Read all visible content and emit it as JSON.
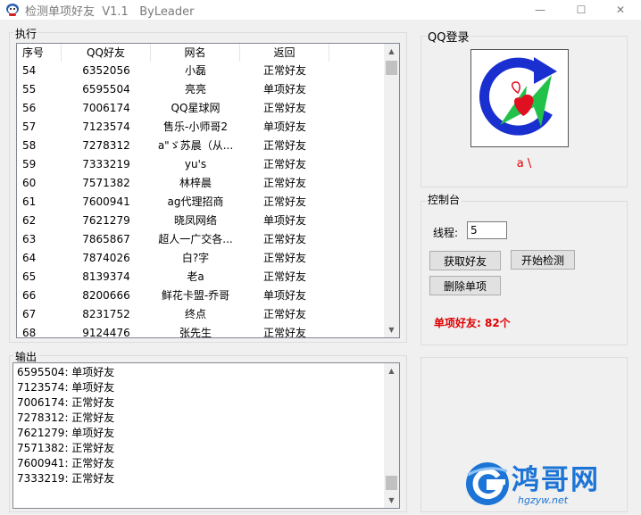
{
  "window": {
    "title": "检测单项好友  V1.1   ByLeader",
    "min_glyph": "—",
    "max_glyph": "☐",
    "close_glyph": "✕"
  },
  "exec": {
    "title": "执行",
    "columns": [
      "序号",
      "QQ好友",
      "网名",
      "返回"
    ],
    "rows": [
      {
        "num": "54",
        "qq": "6352056",
        "name": "小磊",
        "ret": "正常好友"
      },
      {
        "num": "55",
        "qq": "6595504",
        "name": "亮亮",
        "ret": "单项好友"
      },
      {
        "num": "56",
        "qq": "7006174",
        "name": "QQ星球网",
        "ret": "正常好友"
      },
      {
        "num": "57",
        "qq": "7123574",
        "name": "售乐-小师哥2",
        "ret": "单项好友"
      },
      {
        "num": "58",
        "qq": "7278312",
        "name": "a\"ゞ苏晨（从...",
        "ret": "正常好友"
      },
      {
        "num": "59",
        "qq": "7333219",
        "name": "yu's",
        "ret": "正常好友"
      },
      {
        "num": "60",
        "qq": "7571382",
        "name": "林梓晨",
        "ret": "正常好友"
      },
      {
        "num": "61",
        "qq": "7600941",
        "name": "ag代理招商",
        "ret": "正常好友"
      },
      {
        "num": "62",
        "qq": "7621279",
        "name": "晓凤网络",
        "ret": "单项好友"
      },
      {
        "num": "63",
        "qq": "7865867",
        "name": "超人一广交各...",
        "ret": "正常好友"
      },
      {
        "num": "64",
        "qq": "7874026",
        "name": "白?字",
        "ret": "正常好友"
      },
      {
        "num": "65",
        "qq": "8139374",
        "name": "老a",
        "ret": "正常好友"
      },
      {
        "num": "66",
        "qq": "8200666",
        "name": "鲜花卡盟-乔哥",
        "ret": "单项好友"
      },
      {
        "num": "67",
        "qq": "8231752",
        "name": "终点",
        "ret": "正常好友"
      },
      {
        "num": "68",
        "qq": "9124476",
        "name": "张先生",
        "ret": "正常好友"
      }
    ]
  },
  "output": {
    "title": "输出",
    "lines": [
      "6595504: 单项好友",
      "7123574: 单项好友",
      "7006174: 正常好友",
      "7278312: 正常好友",
      "7621279: 单项好友",
      "7571382: 正常好友",
      "7600941: 正常好友",
      "7333219: 正常好友"
    ]
  },
  "qq_login": {
    "title": "QQ登录",
    "nickname": "a \\"
  },
  "console": {
    "title": "控制台",
    "threads_label": "线程:",
    "threads_value": "5",
    "fetch_button": "获取好友",
    "start_button": "开始检测",
    "delete_button": "删除单项",
    "stat_text": "单项好友: 82个"
  },
  "watermark": {
    "text": "鸿哥网",
    "url": "hgzyw.net"
  },
  "colors": {
    "accent_red": "#e00000",
    "watermark_blue": "#1c74d6"
  }
}
